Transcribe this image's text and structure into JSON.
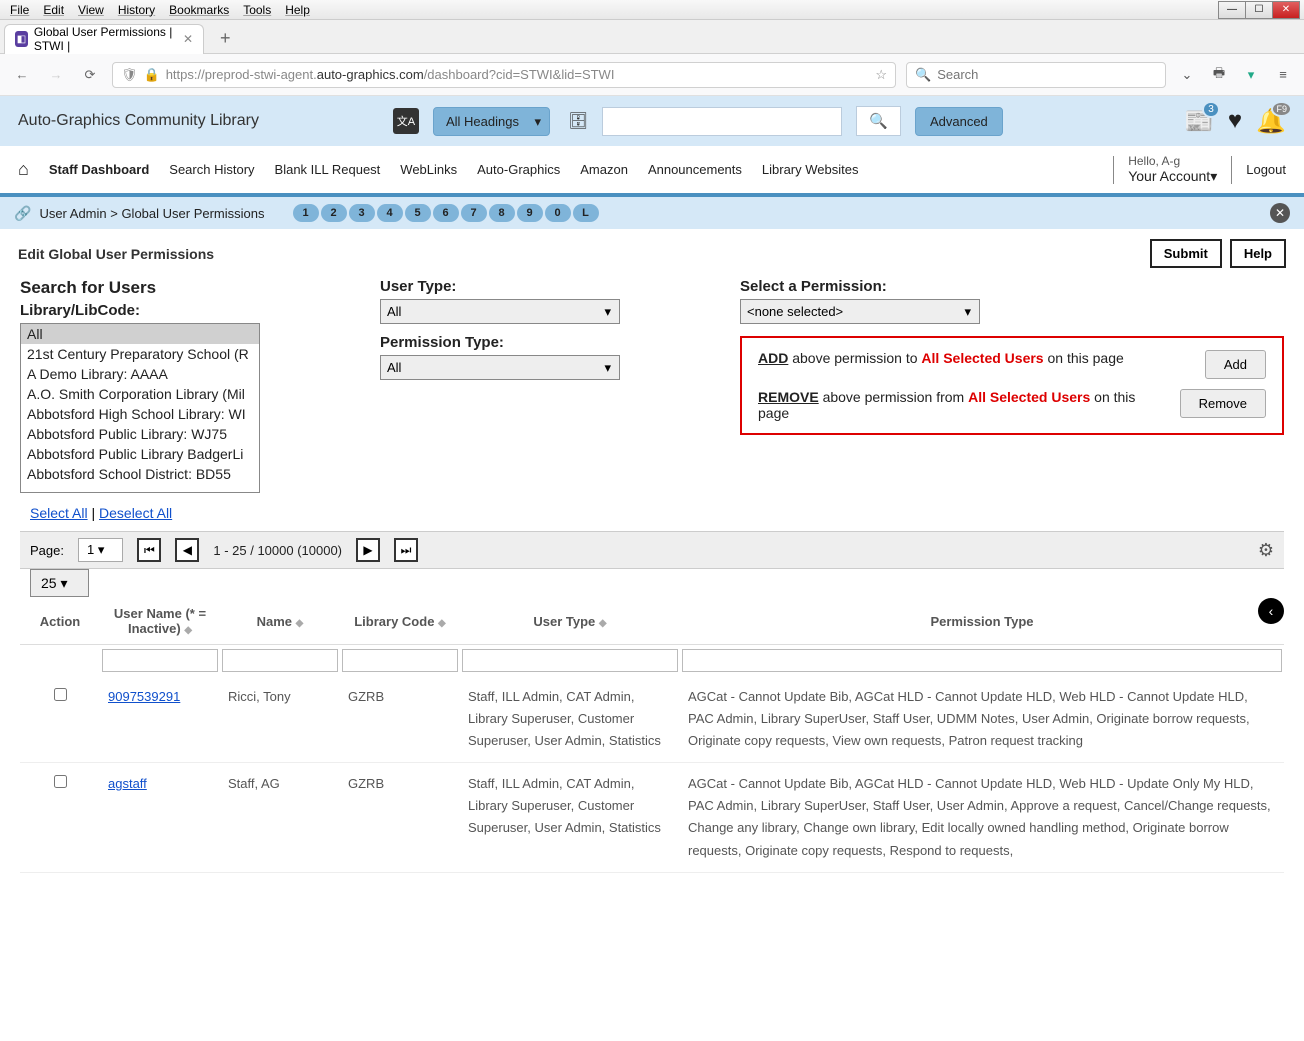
{
  "window": {
    "menus": [
      "File",
      "Edit",
      "View",
      "History",
      "Bookmarks",
      "Tools",
      "Help"
    ]
  },
  "tab": {
    "title": "Global User Permissions | STWI |"
  },
  "url": {
    "prefix": "https://preprod-stwi-agent.",
    "domain": "auto-graphics.com",
    "suffix": "/dashboard?cid=STWI&lid=STWI"
  },
  "browser_search_placeholder": "Search",
  "app": {
    "title": "Auto-Graphics Community Library",
    "headings_dropdown": "All Headings",
    "advanced": "Advanced",
    "news_badge": "3",
    "bell_badge": "F9"
  },
  "nav": {
    "items": [
      "Staff Dashboard",
      "Search History",
      "Blank ILL Request",
      "WebLinks",
      "Auto-Graphics",
      "Amazon",
      "Announcements",
      "Library Websites"
    ],
    "hello": "Hello, A-g",
    "account": "Your Account▾",
    "logout": "Logout"
  },
  "breadcrumb": {
    "text": "User Admin > Global User Permissions",
    "bubbles": [
      "1",
      "2",
      "3",
      "4",
      "5",
      "6",
      "7",
      "8",
      "9",
      "0",
      "L"
    ]
  },
  "page": {
    "title": "Edit Global User Permissions",
    "submit": "Submit",
    "help": "Help"
  },
  "search": {
    "heading": "Search for Users",
    "library_label": "Library/LibCode:",
    "library_options": [
      "All",
      "21st Century Preparatory School (R",
      "A Demo Library: AAAA",
      "A.O. Smith Corporation Library (Mil",
      "Abbotsford High School Library: WI",
      "Abbotsford Public Library: WJ75",
      "Abbotsford Public Library BadgerLi",
      "Abbotsford School District: BD55"
    ],
    "user_type_label": "User Type:",
    "user_type_value": "All",
    "perm_type_label": "Permission Type:",
    "perm_type_value": "All",
    "select_perm_label": "Select a Permission:",
    "select_perm_value": "<none selected>"
  },
  "actions": {
    "add_strong": "ADD",
    "add_text_1": " above permission to ",
    "add_red": "All Selected Users",
    "add_text_2": " on this page",
    "add_btn": "Add",
    "remove_strong": "REMOVE",
    "remove_text_1": " above permission from ",
    "remove_red": "All Selected Users",
    "remove_text_2": " on this page",
    "remove_btn": "Remove"
  },
  "links": {
    "select_all": "Select All",
    "deselect_all": " Deselect All"
  },
  "grid": {
    "page_label": "Page:",
    "page_value": "1",
    "range": "1 - 25 / 10000 (10000)",
    "page_size": "25",
    "columns": {
      "action": "Action",
      "username": "User Name (* = Inactive)",
      "name": "Name",
      "libcode": "Library Code",
      "usertype": "User Type",
      "permtype": "Permission Type"
    }
  },
  "rows": [
    {
      "username": "9097539291",
      "name": "Ricci, Tony",
      "libcode": "GZRB",
      "usertype": "Staff, ILL Admin, CAT Admin, Library Superuser, Customer Superuser, User Admin, Statistics",
      "permtype": "AGCat - Cannot Update Bib, AGCat HLD - Cannot Update HLD, Web HLD - Cannot Update HLD, PAC Admin, Library SuperUser, Staff User, UDMM Notes, User Admin, Originate borrow requests, Originate copy requests, View own requests, Patron request tracking"
    },
    {
      "username": "agstaff",
      "name": "Staff, AG",
      "libcode": "GZRB",
      "usertype": "Staff, ILL Admin, CAT Admin, Library Superuser, Customer Superuser, User Admin, Statistics",
      "permtype": "AGCat - Cannot Update Bib, AGCat HLD - Cannot Update HLD, Web HLD - Update Only My HLD, PAC Admin, Library SuperUser, Staff User, User Admin, Approve a request, Cancel/Change requests, Change any library, Change own library, Edit locally owned handling method, Originate borrow requests, Originate copy requests, Respond to requests,"
    }
  ]
}
